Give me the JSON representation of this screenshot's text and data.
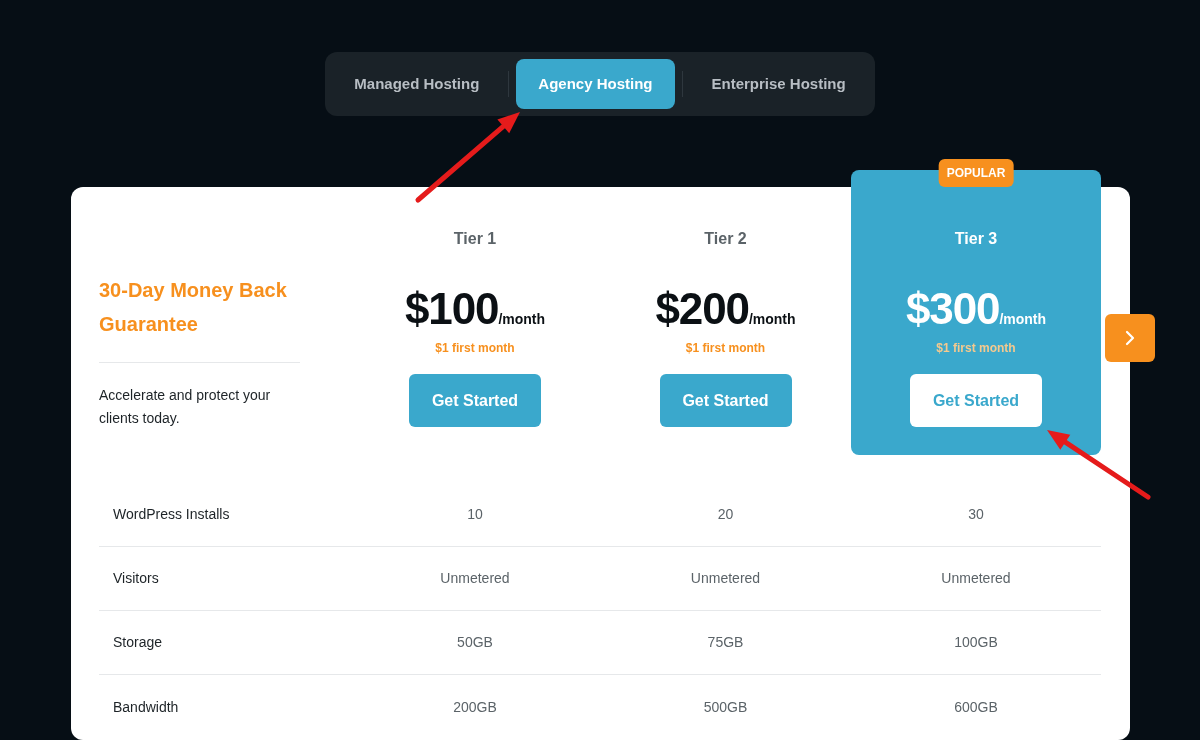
{
  "tabs": [
    {
      "label": "Managed Hosting",
      "selected": false
    },
    {
      "label": "Agency Hosting",
      "selected": true
    },
    {
      "label": "Enterprise Hosting",
      "selected": false
    }
  ],
  "guarantee": {
    "title": "30-Day Money Back Guarantee",
    "text": "Accelerate and protect your clients today."
  },
  "tiers": [
    {
      "name": "Tier 1",
      "price": "$100",
      "period": "/month",
      "promo": "$1 first month",
      "button": "Get Started",
      "highlighted": false
    },
    {
      "name": "Tier 2",
      "price": "$200",
      "period": "/month",
      "promo": "$1 first month",
      "button": "Get Started",
      "highlighted": false
    },
    {
      "name": "Tier 3",
      "price": "$300",
      "period": "/month",
      "promo": "$1 first month",
      "button": "Get Started",
      "highlighted": true,
      "badge": "POPULAR"
    }
  ],
  "features": [
    {
      "label": "WordPress Installs",
      "values": [
        "10",
        "20",
        "30"
      ]
    },
    {
      "label": "Visitors",
      "values": [
        "Unmetered",
        "Unmetered",
        "Unmetered"
      ]
    },
    {
      "label": "Storage",
      "values": [
        "50GB",
        "75GB",
        "100GB"
      ]
    },
    {
      "label": "Bandwidth",
      "values": [
        "200GB",
        "500GB",
        "600GB"
      ]
    }
  ]
}
